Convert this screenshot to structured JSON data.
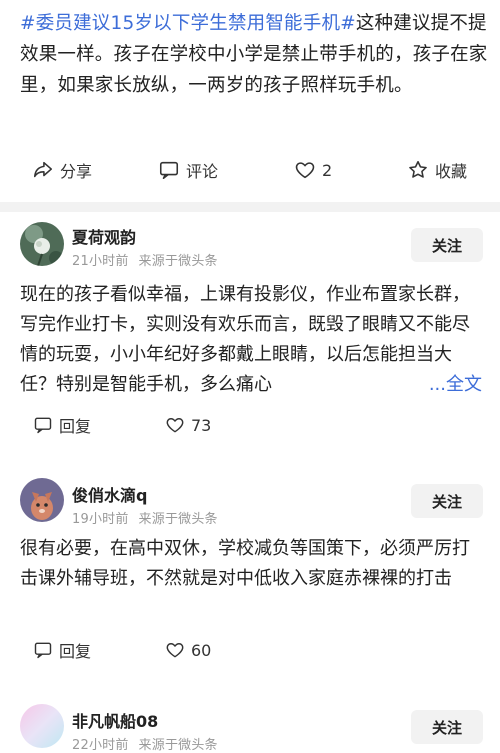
{
  "post": {
    "hashtag": "#委员建议15岁以下学生禁用智能手机#",
    "text": "这种建议提不提效果一样。孩子在学校中小学是禁止带手机的，孩子在家里，如果家长放纵，一两岁的孩子照样玩手机。"
  },
  "actions": {
    "share": "分享",
    "comment": "评论",
    "like_count": "2",
    "favorite": "收藏"
  },
  "comments": [
    {
      "author": "夏荷观韵",
      "time": "21小时前",
      "source": "来源于微头条",
      "follow": "关注",
      "text": "现在的孩子看似幸福，上课有投影仪，作业布置家长群，写完作业打卡，实则没有欢乐而言，既毁了眼睛又不能尽情的玩耍，小小年纪好多都戴上眼睛，以后怎能担当大任？特别是智能手机，多么痛心",
      "more": "...全文",
      "reply": "回复",
      "likes": "73"
    },
    {
      "author": "俊俏水滴q",
      "time": "19小时前",
      "source": "来源于微头条",
      "follow": "关注",
      "text": "很有必要，在高中双休，学校减负等国策下，必须严厉打击课外辅导班，不然就是对中低收入家庭赤裸裸的打击",
      "reply": "回复",
      "likes": "60"
    },
    {
      "author": "非凡帆船08",
      "time": "22小时前",
      "source": "来源于微头条",
      "follow": "关注"
    }
  ],
  "colors": {
    "link": "#3d6dd8",
    "meta": "#999999",
    "button_bg": "#f2f2f2",
    "text": "#222222"
  },
  "icons": {
    "share": "share-icon",
    "comment": "comment-icon",
    "like": "heart-icon",
    "favorite": "star-icon",
    "reply": "reply-icon"
  }
}
